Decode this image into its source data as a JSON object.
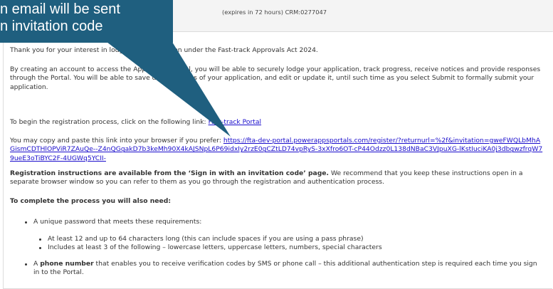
{
  "header": {
    "subject": "(expires in 72 hours) CRM:0277047"
  },
  "callout": {
    "line1": "n email will be sent",
    "line2": "n invitation code"
  },
  "email": {
    "p1": "Thank you for your interest in lodging an application under the Fast-track Approvals Act 2024.",
    "p2": "By creating an account to access the Application Portal, you will be able to securely lodge your application, track progress, receive notices and provide responses through the Portal. You will be able to save draft versions of your application, and edit or update it, until such time as you select Submit to formally submit your application.",
    "p3_prefix": "To begin the registration process, click on the following link: ",
    "p3_link": "Fast-track Portal",
    "p4_prefix": "You may copy and paste this link into your browser if you prefer: ",
    "p4_url": "https://fta-dev-portal.powerappsportals.com/register/?returnurl=%2f&invitation=gweFWQLbMhAGismCDTHlOPViR7ZAuQe--Z4nQGgakD7b3keMh90X4kAJSNpL6P69idxIy2rzE0gCZtLD74vpRyS-3xXfro6OT-cP44Odzz0L138dNBaC3VJpuXG-lKstIuciKA0j3dbgwzfrqW79ueE3oTiBYC2F-4UGWq5YCII-",
    "p5_bold": "Registration instructions are available from the ‘Sign in with an invitation code’ page.",
    "p5_rest": " We recommend that you keep these instructions open in a separate browser window so you can refer to them as you go through the registration and authentication process.",
    "p6": "To complete the process you will also need:",
    "list_item1": "A unique password that meets these requirements:",
    "sub_items": [
      "At least 12 and up to 64 characters long (this can include spaces if you are using a pass phrase)",
      "Includes at least 3 of the following – lowercase letters, uppercase letters, numbers, special characters"
    ],
    "list_item2_prefix": "A ",
    "list_item2_bold": "phone number",
    "list_item2_rest": " that enables you to receive verification codes by SMS or phone call – this additional authentication step is required each time you sign in to the Portal."
  },
  "colors": {
    "callout_bg": "#1f5f7f",
    "link": "#1a0dcc"
  }
}
